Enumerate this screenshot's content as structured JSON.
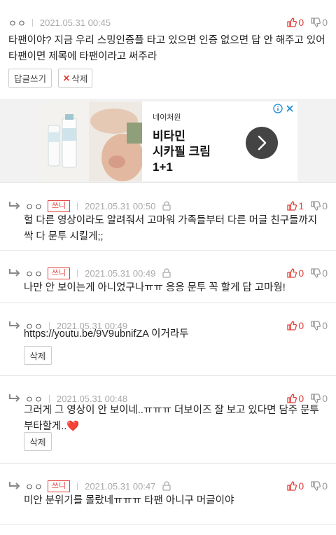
{
  "comments": [
    {
      "nick": "ㅇㅇ",
      "date": "2021.05.31 00:45",
      "up": "0",
      "down": "0",
      "text": "타팬이야? 지금 우리 스밍인증플 타고 있으면 인증 없으면 답 안 해주고 있어 타팬이면 제목에 타팬이라고 써주라",
      "reply_button": "답글쓰기",
      "delete_button": "삭제"
    },
    {
      "nick": "ㅇㅇ",
      "badge": "쓰니",
      "date": "2021.05.31 00:50",
      "up": "1",
      "down": "0",
      "text": "헐 다른 영상이라도 알려줘서 고마워 가족들부터 다른 머글 친구들까지 싹 다 문투 시킬게;;"
    },
    {
      "nick": "ㅇㅇ",
      "badge": "쓰니",
      "date": "2021.05.31 00:49",
      "up": "0",
      "down": "0",
      "text": "나만 안 보이는게 아니었구나ㅠㅠ 응응 문투 꼭 할게 답 고마웡!"
    },
    {
      "nick": "ㅇㅇ",
      "date": "2021.05.31 00:49",
      "up": "0",
      "down": "0",
      "text": "https://youtu.be/9V9ubnifZA 이거라두",
      "delete_button": "삭제"
    },
    {
      "nick": "ㅇㅇ",
      "date": "2021.05.31 00:48",
      "up": "0",
      "down": "0",
      "text": "그러게 그 영상이 안 보이네..ㅠㅠㅠ 더보이즈 잘 보고 있다면 담주 문투 부타할게..❤️",
      "delete_button": "삭제"
    },
    {
      "nick": "ㅇㅇ",
      "badge": "쓰니",
      "date": "2021.05.31 00:47",
      "up": "0",
      "down": "0",
      "text": "미안 분위기를 몰랐네ㅠㅠㅠ 타팬 아니구 머글이야"
    }
  ],
  "ad": {
    "brand": "네이처원",
    "headline": "비타민\n시카필 크림\n1+1",
    "icons": [
      "ad-info-icon",
      "ad-close-icon",
      "chevron-right-icon"
    ]
  },
  "colors": {
    "accent_red": "#e0403a",
    "meta_gray": "#999999",
    "ad_bg": "#f2f2f2"
  }
}
